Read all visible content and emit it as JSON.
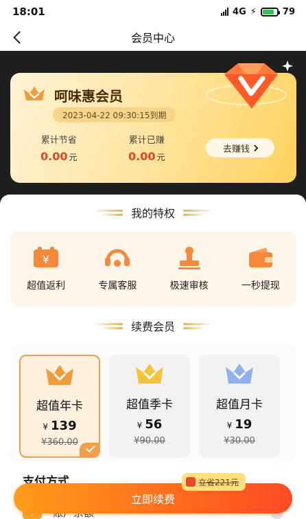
{
  "status": {
    "time": "18:01",
    "network": "4G",
    "battery": "79",
    "battery_level_pct": 79
  },
  "nav": {
    "title": "会员中心"
  },
  "card": {
    "title": "呵味惠会员",
    "expire": "2023-04-22 09:30:15到期",
    "saved_label": "累计节省",
    "saved_value": "0.00",
    "earned_label": "累计已赚",
    "earned_value": "0.00",
    "unit": "元",
    "earn_button": "去赚钱"
  },
  "privileges": {
    "title": "我的特权",
    "items": [
      {
        "label": "超值返利",
        "icon": "rebate-icon"
      },
      {
        "label": "专属客服",
        "icon": "headset-icon"
      },
      {
        "label": "极速审核",
        "icon": "stamp-icon"
      },
      {
        "label": "一秒提现",
        "icon": "wallet-icon"
      }
    ]
  },
  "renew": {
    "title": "续费会员",
    "plans": [
      {
        "name": "超值年卡",
        "currency": "¥",
        "price": "139",
        "original": "¥360.00",
        "selected": true,
        "crown_color": "#f29b3a"
      },
      {
        "name": "超值季卡",
        "currency": "¥",
        "price": "56",
        "original": "¥90.00",
        "selected": false,
        "crown_color": "#f3c33c"
      },
      {
        "name": "超值月卡",
        "currency": "¥",
        "price": "19",
        "original": "¥30.00",
        "selected": false,
        "crown_color": "#8fb0ea"
      }
    ]
  },
  "payment": {
    "title": "支付方式",
    "account_label": "账户余额",
    "account_icon_text": "¥"
  },
  "save_badge": "立省221元",
  "renew_button": "立即续费",
  "colors": {
    "accent": "#ff6a1d",
    "price_red": "#e2461e",
    "card_gold": "#ffd25e"
  }
}
